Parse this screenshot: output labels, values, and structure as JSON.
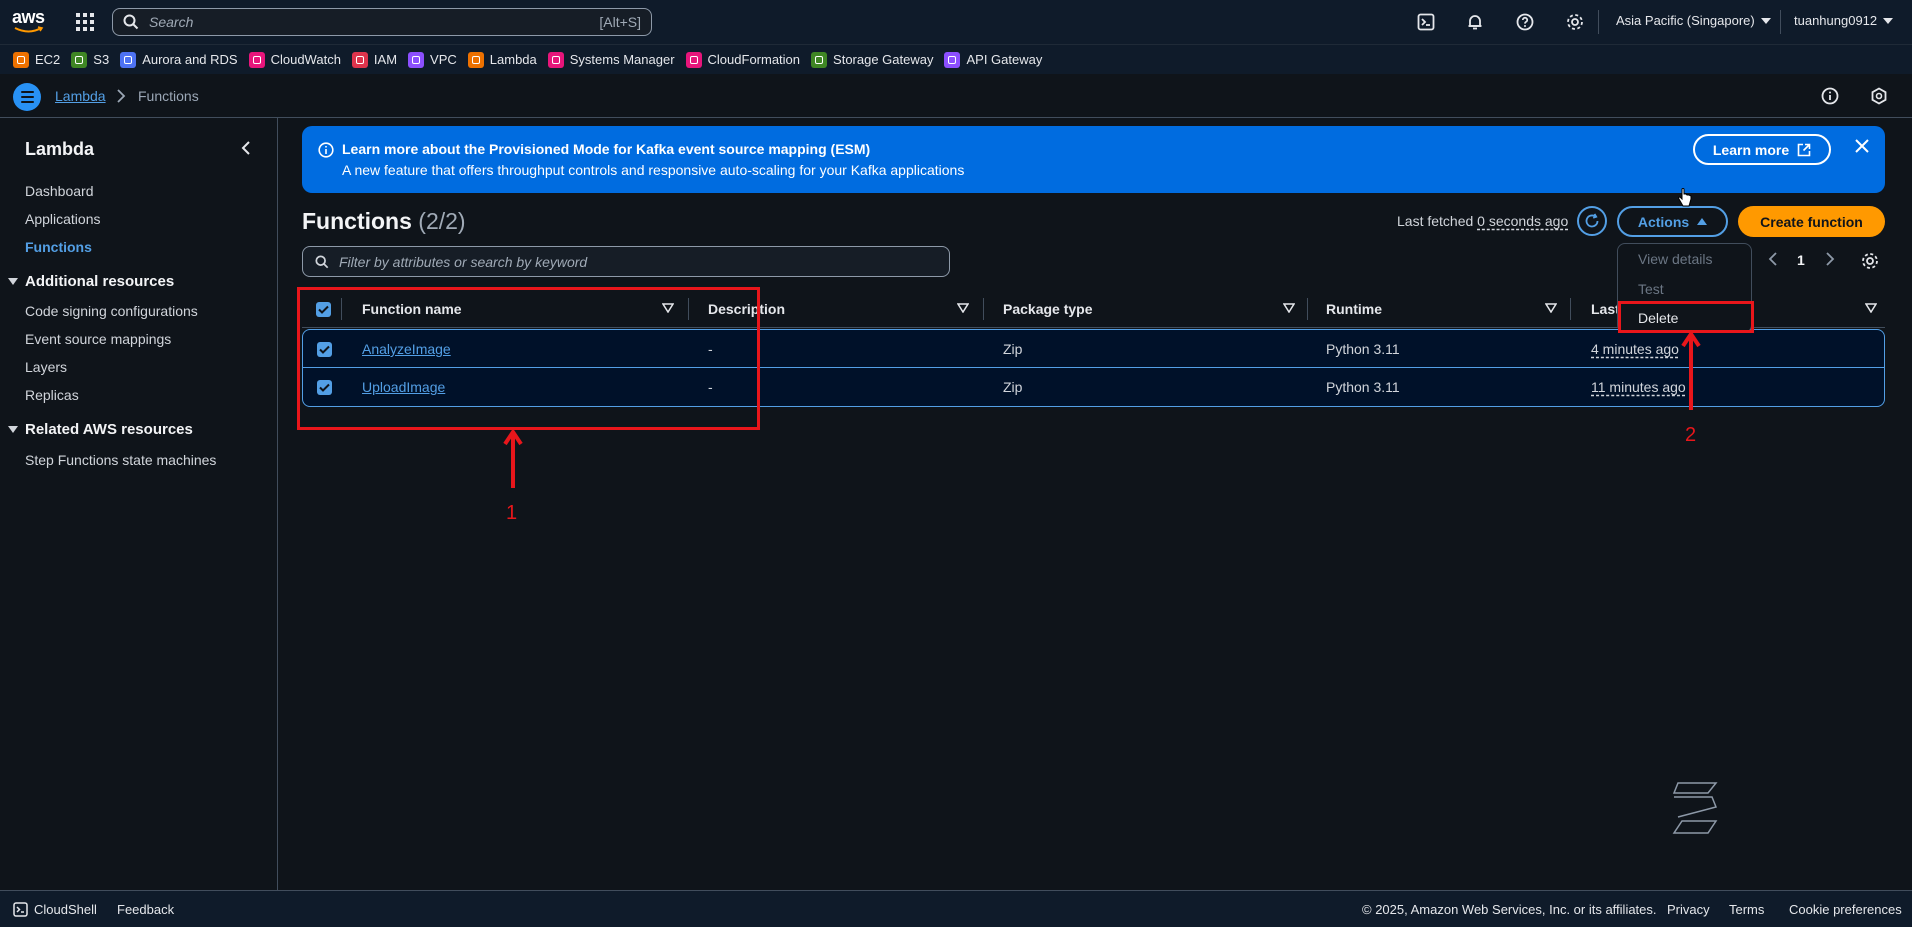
{
  "topnav": {
    "logo_text": "aws",
    "search_placeholder": "Search",
    "search_shortcut": "[Alt+S]",
    "region": "Asia Pacific (Singapore)",
    "user": "tuanhung0912"
  },
  "favorites": [
    {
      "label": "EC2",
      "color": "#ed7100"
    },
    {
      "label": "S3",
      "color": "#3f8624"
    },
    {
      "label": "Aurora and RDS",
      "color": "#4d72f3"
    },
    {
      "label": "CloudWatch",
      "color": "#e7157b"
    },
    {
      "label": "IAM",
      "color": "#dd344c"
    },
    {
      "label": "VPC",
      "color": "#8c4fff"
    },
    {
      "label": "Lambda",
      "color": "#ed7100"
    },
    {
      "label": "Systems Manager",
      "color": "#e7157b"
    },
    {
      "label": "CloudFormation",
      "color": "#e7157b"
    },
    {
      "label": "Storage Gateway",
      "color": "#3f8624"
    },
    {
      "label": "API Gateway",
      "color": "#8c4fff"
    }
  ],
  "breadcrumb": {
    "root": "Lambda",
    "current": "Functions"
  },
  "sidebar": {
    "title": "Lambda",
    "items": [
      "Dashboard",
      "Applications",
      "Functions"
    ],
    "section1": {
      "title": "Additional resources",
      "items": [
        "Code signing configurations",
        "Event source mappings",
        "Layers",
        "Replicas"
      ]
    },
    "section2": {
      "title": "Related AWS resources",
      "items": [
        "Step Functions state machines"
      ]
    }
  },
  "banner": {
    "title": "Learn more about the Provisioned Mode for Kafka event source mapping (ESM)",
    "text": "A new feature that offers throughput controls and responsive auto-scaling for your Kafka applications",
    "button": "Learn more"
  },
  "main": {
    "title": "Functions",
    "count": "(2/2)",
    "last_fetched_label": "Last fetched",
    "last_fetched_value": "0 seconds ago",
    "actions_label": "Actions",
    "create_label": "Create function",
    "filter_placeholder": "Filter by attributes or search by keyword",
    "page": "1",
    "dropdown": [
      "View details",
      "Test",
      "Delete"
    ]
  },
  "table": {
    "columns": [
      "Function name",
      "Description",
      "Package type",
      "Runtime",
      "Last"
    ],
    "rows": [
      {
        "name": "AnalyzeImage",
        "description": "-",
        "package": "Zip",
        "runtime": "Python 3.11",
        "last": "4 minutes ago"
      },
      {
        "name": "UploadImage",
        "description": "-",
        "package": "Zip",
        "runtime": "Python 3.11",
        "last": "11 minutes ago"
      }
    ]
  },
  "annotations": {
    "label1": "1",
    "label2": "2",
    "color": "#e8161b"
  },
  "footer": {
    "cloudshell": "CloudShell",
    "feedback": "Feedback",
    "copyright": "© 2025, Amazon Web Services, Inc. or its affiliates.",
    "privacy": "Privacy",
    "terms": "Terms",
    "cookies": "Cookie preferences"
  }
}
